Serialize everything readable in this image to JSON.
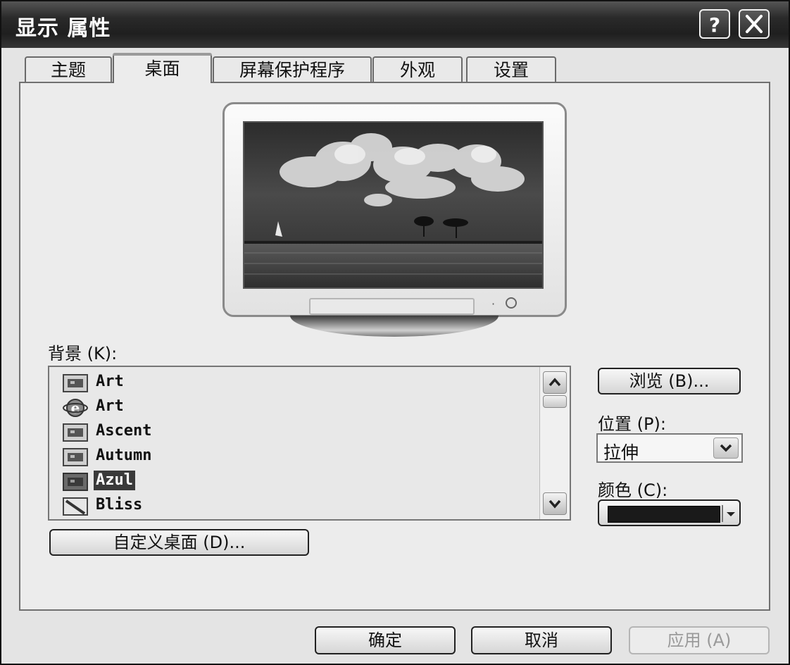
{
  "window": {
    "title": "显示 属性",
    "help_label": "?",
    "close_label": "×"
  },
  "tabs": [
    {
      "label": "主题",
      "active": false
    },
    {
      "label": "桌面",
      "active": true
    },
    {
      "label": "屏幕保护程序",
      "active": false
    },
    {
      "label": "外观",
      "active": false
    },
    {
      "label": "设置",
      "active": false
    }
  ],
  "background_label": "背景 (K):",
  "background_list": [
    {
      "label": "Art",
      "icon": "image-file-icon",
      "selected": false
    },
    {
      "label": "Art",
      "icon": "internet-explorer-icon",
      "selected": false
    },
    {
      "label": "Ascent",
      "icon": "image-file-icon",
      "selected": false
    },
    {
      "label": "Autumn",
      "icon": "image-file-icon",
      "selected": false
    },
    {
      "label": "Azul",
      "icon": "image-file-icon",
      "selected": true
    },
    {
      "label": "Bliss",
      "icon": "bitmap-file-icon",
      "selected": false
    }
  ],
  "browse_button": "浏览 (B)...",
  "position": {
    "label": "位置 (P):",
    "value": "拉伸"
  },
  "color": {
    "label": "颜色 (C):",
    "value": "#1a1a1a"
  },
  "customize_button": "自定义桌面 (D)...",
  "footer": {
    "ok": "确定",
    "cancel": "取消",
    "apply": "应用 (A)"
  }
}
